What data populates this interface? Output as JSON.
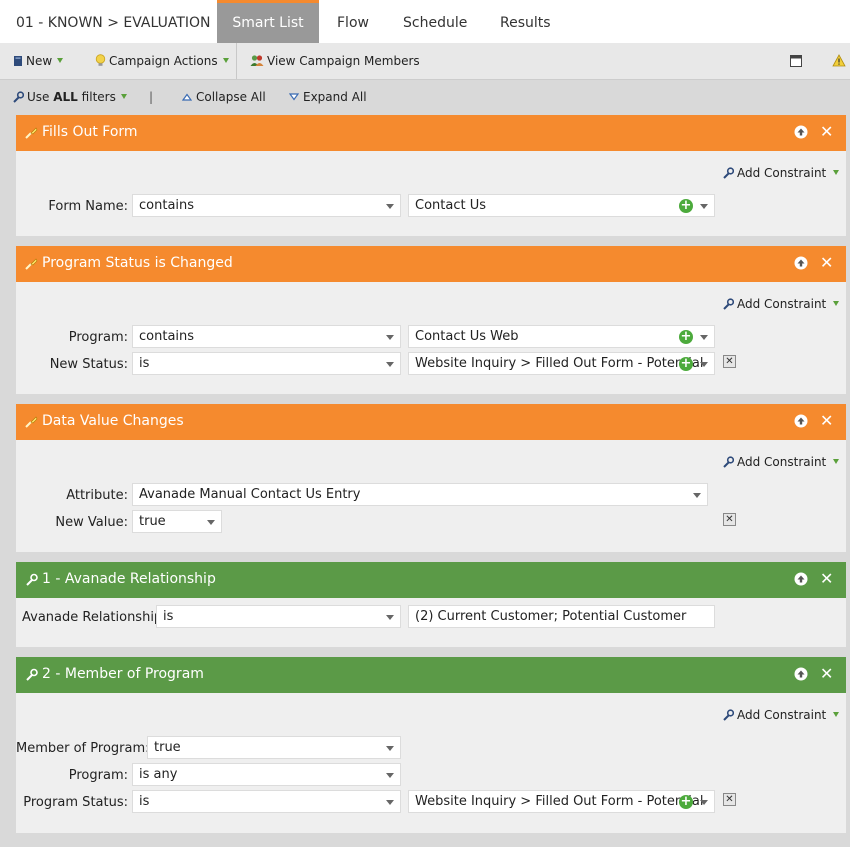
{
  "tabs": {
    "breadcrumb": "01 - KNOWN > EVALUATION",
    "items": [
      {
        "label": "Smart List"
      },
      {
        "label": "Flow"
      },
      {
        "label": "Schedule"
      },
      {
        "label": "Results"
      }
    ]
  },
  "toolbar": {
    "new_label": "New",
    "campaign_actions_label": "Campaign Actions",
    "view_members_label": "View Campaign Members"
  },
  "filterbar": {
    "use_filters_prefix": "Use",
    "use_filters_bold": "ALL",
    "use_filters_suffix": "filters",
    "separator": "|",
    "collapse_label": "Collapse All",
    "expand_label": "Expand All"
  },
  "colors": {
    "trigger_header": "#f58a2e",
    "filter_header": "#5b9a47",
    "active_tab": "#999999"
  },
  "add_constraint_label": "Add Constraint",
  "panels": [
    {
      "title": "Fills Out Form",
      "kind": "trigger",
      "rows": [
        {
          "label": "Form Name:",
          "operator": "contains",
          "value": "Contact Us"
        }
      ]
    },
    {
      "title": "Program Status is Changed",
      "kind": "trigger",
      "rows": [
        {
          "label": "Program:",
          "operator": "contains",
          "value": "Contact Us Web"
        },
        {
          "label": "New Status:",
          "operator": "is",
          "value": "Website Inquiry > Filled Out Form - Potential"
        }
      ]
    },
    {
      "title": "Data Value Changes",
      "kind": "trigger",
      "rows": [
        {
          "label": "Attribute:",
          "operator": "Avanade Manual Contact Us Entry"
        },
        {
          "label": "New Value:",
          "operator": "true"
        }
      ]
    },
    {
      "title": "1 - Avanade Relationship",
      "kind": "filter",
      "rows": [
        {
          "label": "Avanade Relationship:",
          "operator": "is",
          "value": "(2) Current Customer; Potential Customer"
        }
      ]
    },
    {
      "title": "2 - Member of Program",
      "kind": "filter",
      "rows": [
        {
          "label": "Member of Program:",
          "operator": "true"
        },
        {
          "label": "Program:",
          "operator": "is any"
        },
        {
          "label": "Program Status:",
          "operator": "is",
          "value": "Website Inquiry > Filled Out Form - Potential"
        }
      ]
    }
  ]
}
